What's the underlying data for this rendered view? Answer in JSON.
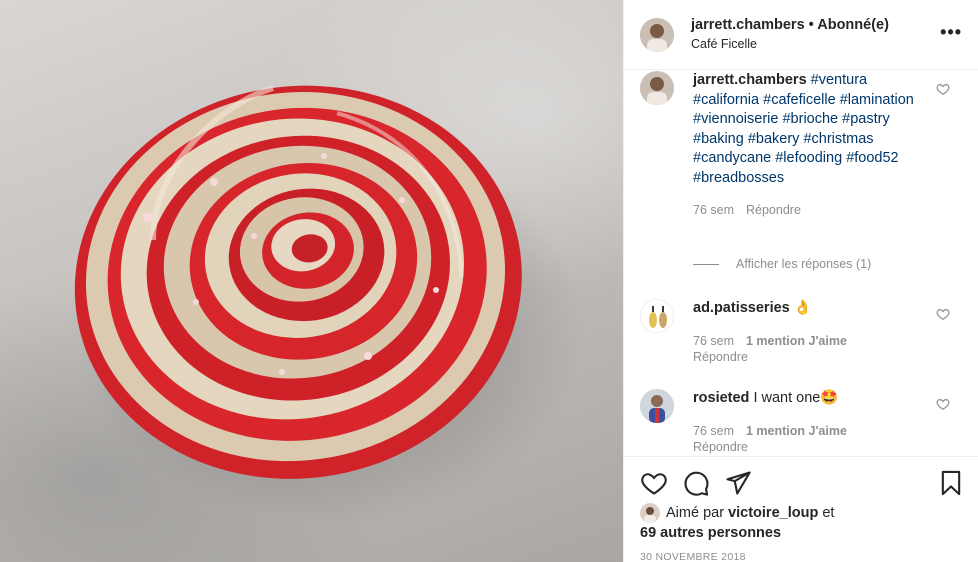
{
  "header": {
    "username": "jarrett.chambers",
    "separator": " • ",
    "follow_status": "Abonné(e)",
    "location": "Café Ficelle",
    "more_glyph": "•••"
  },
  "caption": {
    "username": "jarrett.chambers",
    "hashtags": [
      "#ventura",
      "#california",
      "#cafeficelle",
      "#lamination",
      "#viennoiserie",
      "#brioche",
      "#pastry",
      "#baking",
      "#bakery",
      "#christmas",
      "#candycane",
      "#lefooding",
      "#food52",
      "#breadbosses"
    ],
    "time": "76 sem",
    "reply_label": "Répondre",
    "view_replies": "Afficher les réponses (1)"
  },
  "comments": [
    {
      "username": "ad.patisseries",
      "text": "",
      "emoji": "👌",
      "time": "76 sem",
      "likes": "1 mention J'aime",
      "reply_label": "Répondre"
    },
    {
      "username": "rosieted",
      "text": "I want one",
      "emoji": "🤩",
      "time": "76 sem",
      "likes": "1 mention J'aime",
      "reply_label": "Répondre"
    }
  ],
  "likes": {
    "prefix": "Aimé par",
    "user": "victoire_loup",
    "conjunction": "et",
    "others": "69 autres personnes"
  },
  "date": "30 NOVEMBRE 2018",
  "colors": {
    "hashtag": "#00376b",
    "muted": "#8e8e8e",
    "text": "#262626",
    "border": "#efefef",
    "pastry_red": "#d8282e",
    "pastry_dough": "#d9c9b1"
  },
  "icons": [
    "more-icon",
    "heart-icon",
    "comment-icon",
    "share-icon",
    "bookmark-icon"
  ]
}
